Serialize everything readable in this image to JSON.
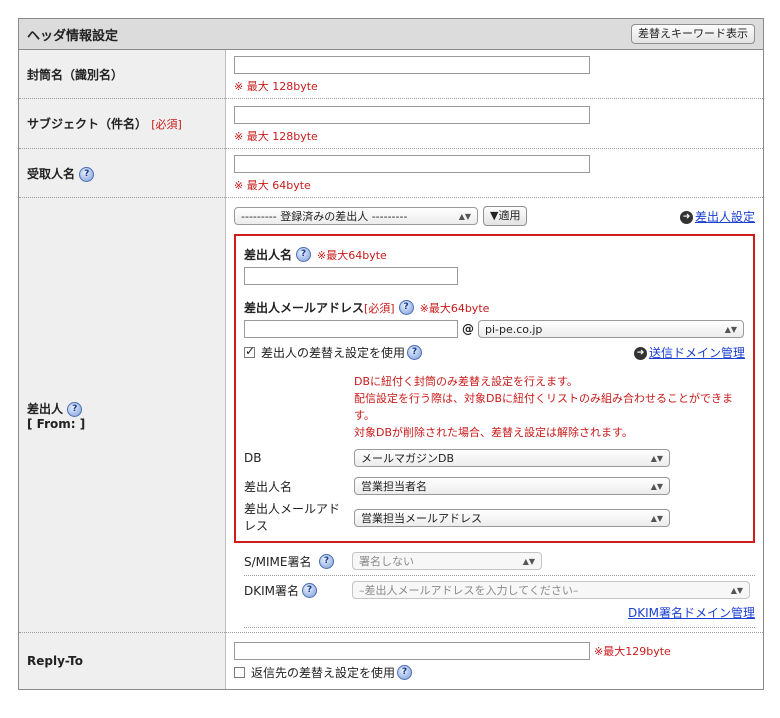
{
  "header": {
    "title": "ヘッダ情報設定",
    "toggle_button": "差替えキーワード表示"
  },
  "envelope": {
    "label": "封筒名（識別名）",
    "value": "",
    "note": "※ 最大 128byte"
  },
  "subject": {
    "label": "サブジェクト（件名）",
    "required": "[必須]",
    "value": "",
    "note": "※ 最大 128byte"
  },
  "recipient": {
    "label": "受取人名",
    "value": "",
    "note": "※ 最大 64byte"
  },
  "from": {
    "label": "差出人",
    "label_sub": "[ From: ]",
    "preset_select": "--------- 登録済みの差出人 ---------",
    "apply_button": "▼適用",
    "sender_settings_link": "差出人設定",
    "sender_name_label": "差出人名",
    "sender_name_note": "※最大64byte",
    "sender_name_value": "",
    "sender_address_label": "差出人メールアドレス",
    "sender_address_required": "[必須]",
    "sender_address_note": "※最大64byte",
    "sender_address_value": "",
    "at_sign": "@",
    "domain_select": "pi-pe.co.jp",
    "replace_checkbox_label": "差出人の差替え設定を使用",
    "domain_manage_link": "送信ドメイン管理",
    "info_lines": [
      "DBに紐付く封筒のみ差替え設定を行えます。",
      "配信設定を行う際は、対象DBに紐付くリストのみ組み合わせることができます。",
      "対象DBが削除された場合、差替え設定は解除されます。"
    ],
    "db_label": "DB",
    "db_select": "メールマガジンDB",
    "name_field_label": "差出人名",
    "name_field_select": "営業担当者名",
    "addr_field_label": "差出人メールアドレス",
    "addr_field_select": "営業担当メールアドレス",
    "smime_label": "S/MIME署名",
    "smime_select": "署名しない",
    "dkim_label": "DKIM署名",
    "dkim_select": "–差出人メールアドレスを入力してください–",
    "dkim_link": "DKIM署名ドメイン管理"
  },
  "reply_to": {
    "label": "Reply-To",
    "value": "",
    "note": "※最大129byte",
    "checkbox_label": "返信先の差替え設定を使用"
  },
  "help_icon_glyph": "?",
  "link_icon_glyph": "➜"
}
